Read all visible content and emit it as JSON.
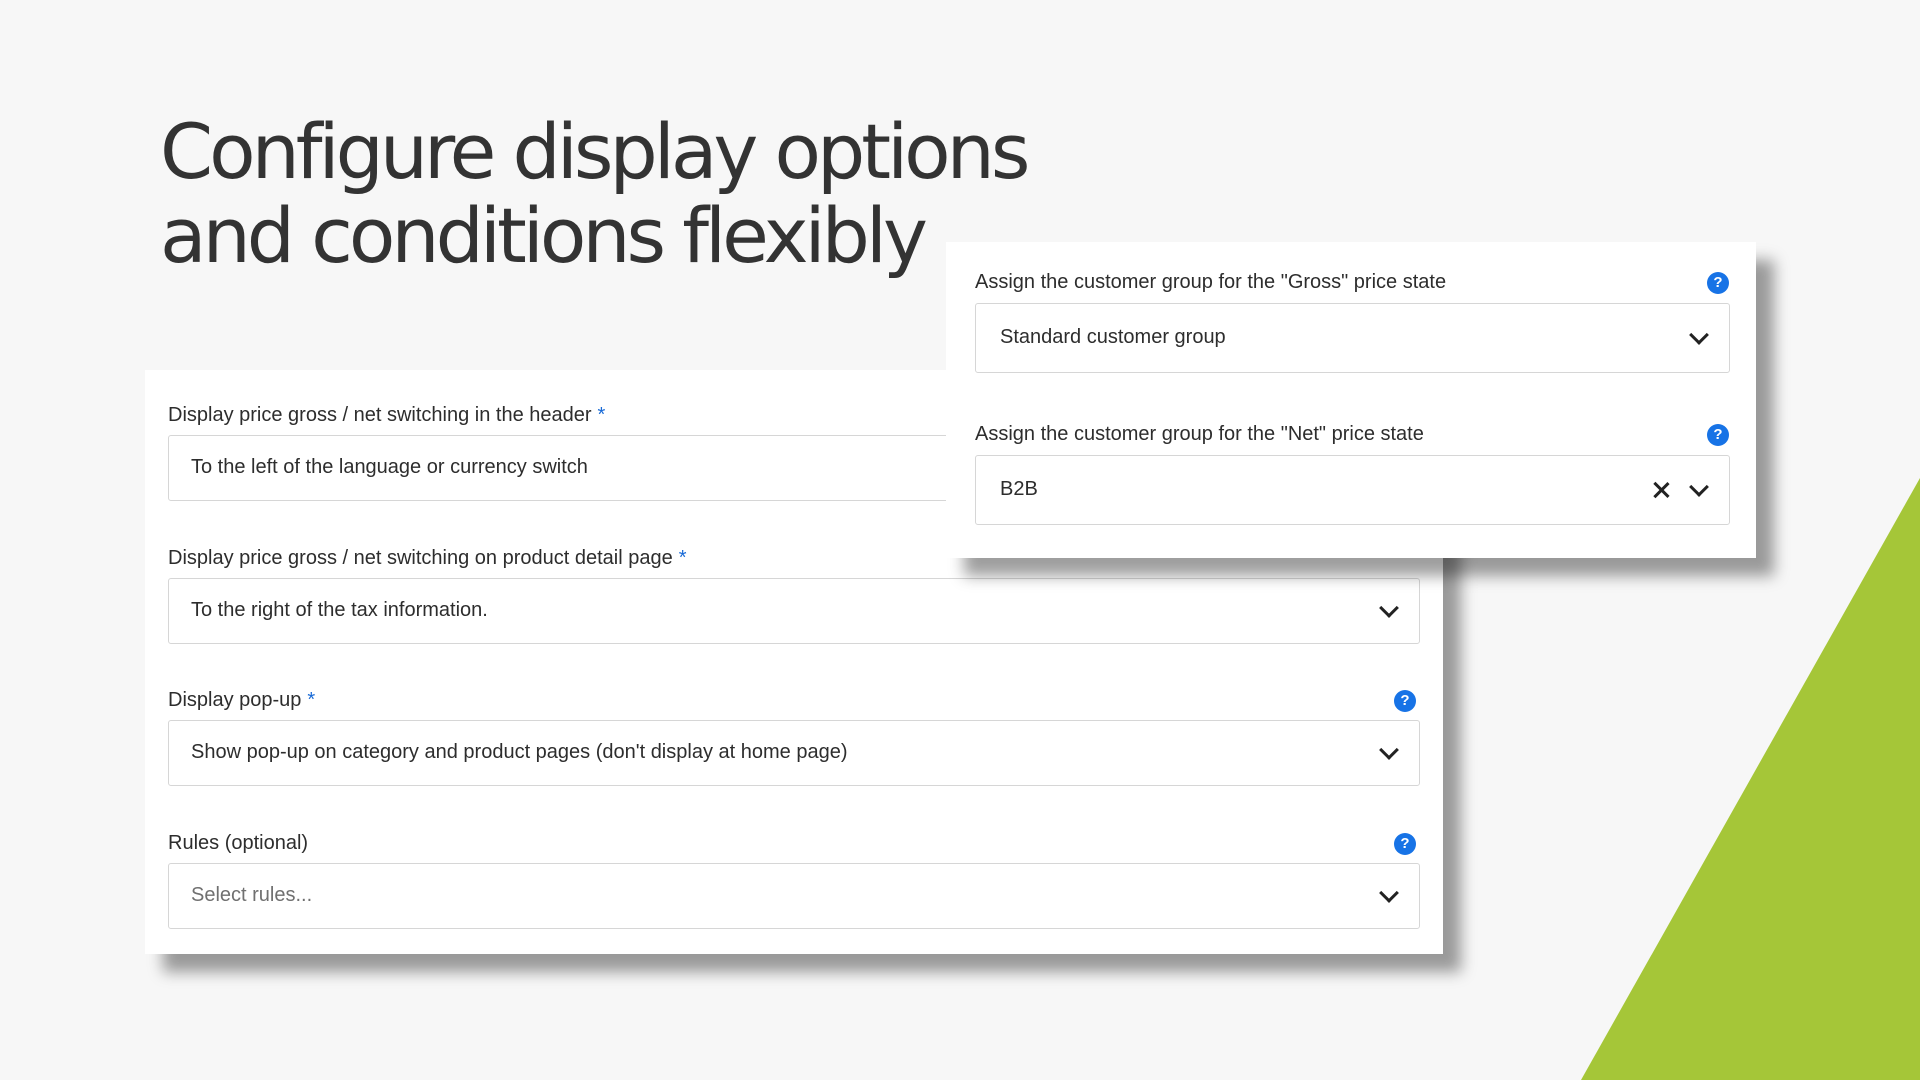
{
  "headline": {
    "line1": "Configure display options",
    "line2": "and conditions flexibly"
  },
  "colors": {
    "background": "#f7f7f7",
    "accent_green": "#a5c638",
    "help_blue": "#1773e6",
    "required_blue": "#1769d6"
  },
  "main_form": {
    "header_switch": {
      "label": "Display price gross / net switching in the header",
      "required_mark": "*",
      "value": "To the left of the language or currency switch",
      "icon": "chevron-down-icon"
    },
    "detail_switch": {
      "label": "Display price gross / net switching on product detail page",
      "required_mark": "*",
      "value": "To the right of the tax information.",
      "icon": "chevron-down-icon"
    },
    "popup": {
      "label": "Display pop-up",
      "required_mark": "*",
      "help": "?",
      "value": "Show pop-up on category and product pages (don't display at home page)",
      "icon": "chevron-down-icon"
    },
    "rules": {
      "label": "Rules (optional)",
      "help": "?",
      "placeholder": "Select rules...",
      "icon": "chevron-down-icon"
    }
  },
  "customer_groups": {
    "gross": {
      "label": "Assign the customer group for the \"Gross\" price state",
      "help": "?",
      "value": "Standard customer group",
      "icon": "chevron-down-icon"
    },
    "net": {
      "label": "Assign the customer group for the \"Net\" price state",
      "help": "?",
      "value": "B2B",
      "icons": [
        "close-icon",
        "chevron-down-icon"
      ]
    }
  }
}
